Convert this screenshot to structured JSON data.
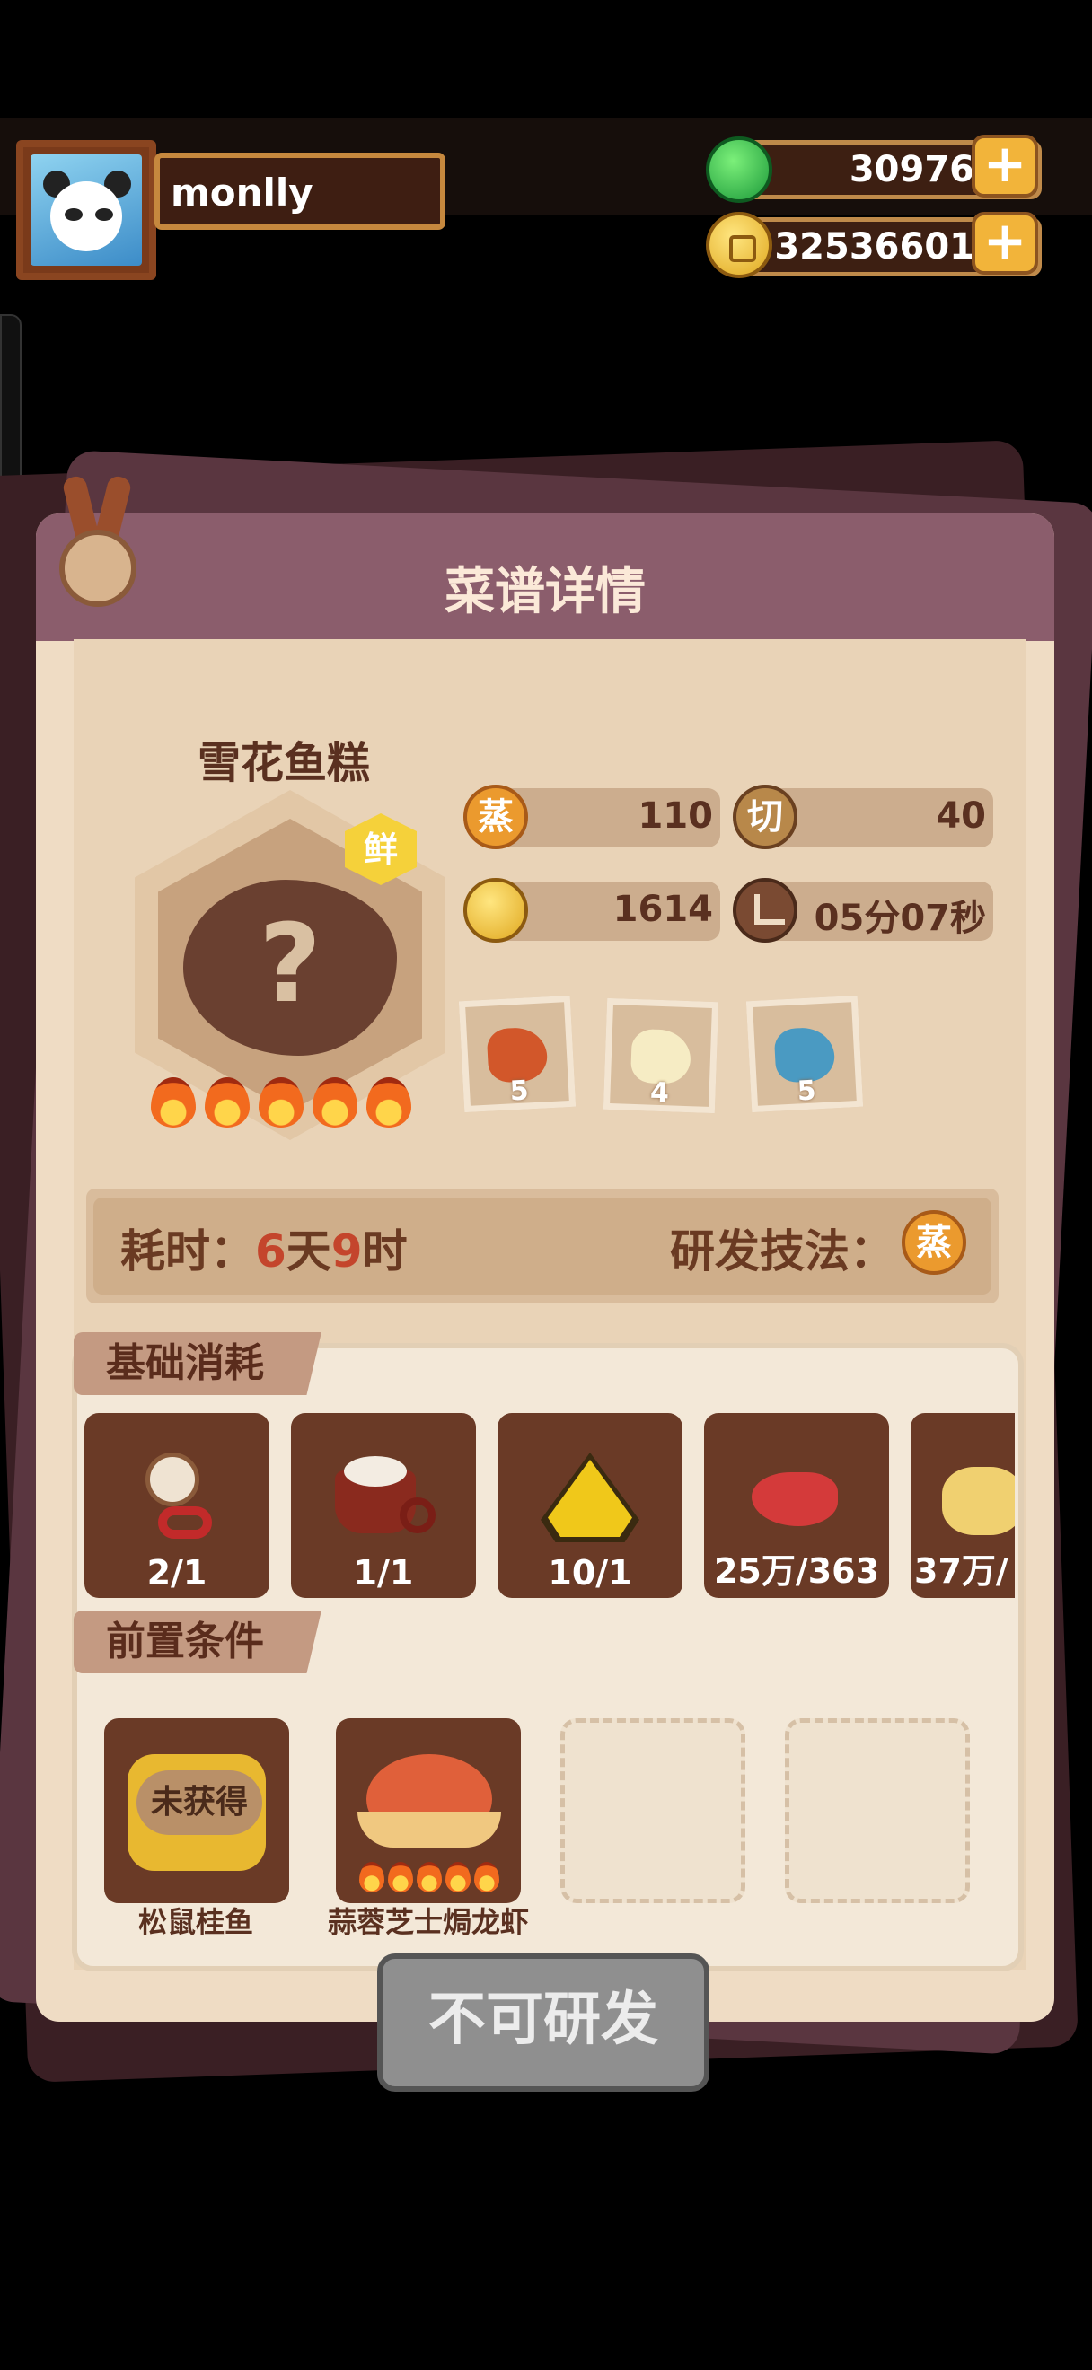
{
  "player": {
    "name": "monlly"
  },
  "currency": {
    "jade": "30976",
    "coins": "32536601"
  },
  "panel": {
    "title": "菜谱详情"
  },
  "dish": {
    "name": "雪花鱼糕",
    "tag": "鲜",
    "flame_count": 5,
    "stats": {
      "steam_icon": "蒸",
      "steam_value": "110",
      "cut_icon": "切",
      "cut_value": "40",
      "price_value": "1614",
      "time_value": "05分07秒"
    },
    "ingredients": [
      {
        "icon": "meat-icon",
        "count": "5"
      },
      {
        "icon": "bamboo-shoot-icon",
        "count": "4"
      },
      {
        "icon": "fish-icon",
        "count": "5"
      }
    ]
  },
  "research": {
    "time_label": "耗时：",
    "days": "6",
    "days_unit": "天",
    "hours": "9",
    "hours_unit": "时",
    "technique_label": "研发技法：",
    "technique_icon": "蒸"
  },
  "basic_consumption": {
    "title": "基础消耗",
    "items": [
      {
        "icon": "scissors-icon",
        "qty": "2/1"
      },
      {
        "icon": "rice-pot-icon",
        "qty": "1/1"
      },
      {
        "icon": "gold-token-icon",
        "qty": "10/1"
      },
      {
        "icon": "raw-meat-icon",
        "qty": "25万/363"
      },
      {
        "icon": "bread-icon",
        "qty": "37万/"
      }
    ]
  },
  "prerequisites": {
    "title": "前置条件",
    "items": [
      {
        "name": "松鼠桂鱼",
        "status": "未获得"
      },
      {
        "name": "蒜蓉芝士焗龙虾",
        "status": ""
      }
    ]
  },
  "action_button": {
    "label": "不可研发"
  },
  "colors": {
    "header": "#8b5d6c",
    "card": "#efdcc4",
    "slot": "#6a3a26",
    "button_disabled": "#8f8f8f"
  }
}
